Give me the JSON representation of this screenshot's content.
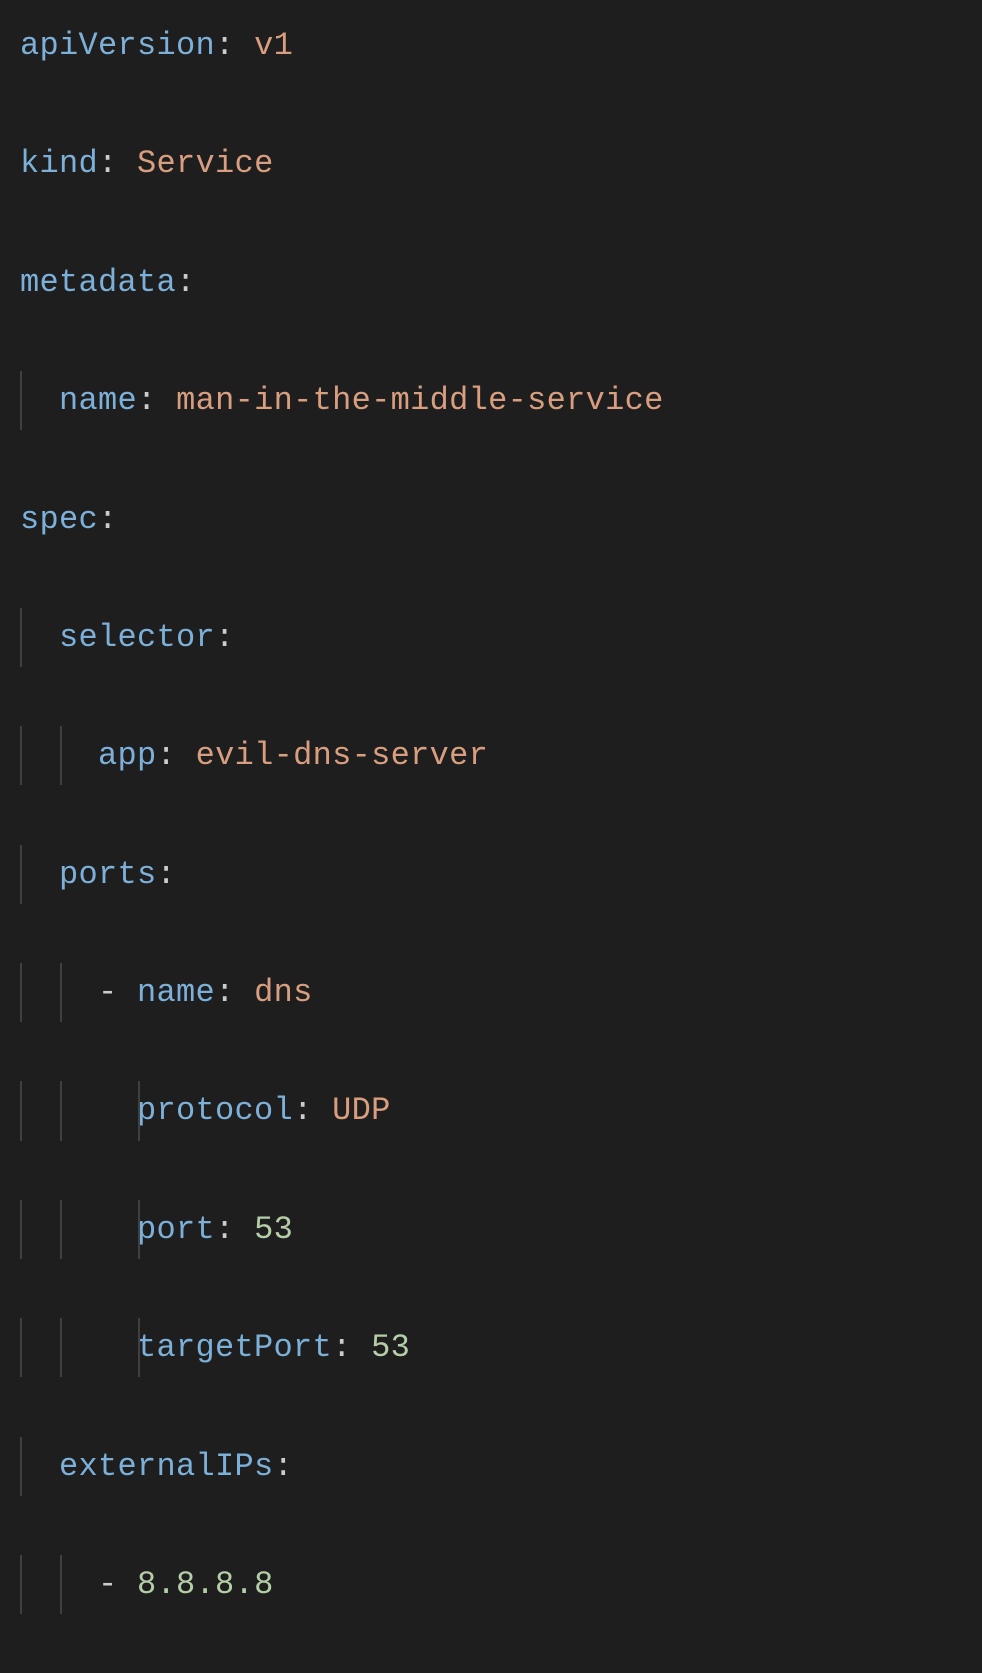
{
  "yaml": {
    "apiVersion_key": "apiVersion",
    "apiVersion_val": "v1",
    "kind_key": "kind",
    "kind_val": "Service",
    "metadata_key": "metadata",
    "metadata_name_key": "name",
    "metadata_name_val": "man-in-the-middle-service",
    "spec_key": "spec",
    "selector_key": "selector",
    "selector_app_key": "app",
    "selector_app_val": "evil-dns-server",
    "ports_key": "ports",
    "ports_name_key": "name",
    "ports_name_val": "dns",
    "ports_protocol_key": "protocol",
    "ports_protocol_val": "UDP",
    "ports_port_key": "port",
    "ports_port_val": "53",
    "ports_targetPort_key": "targetPort",
    "ports_targetPort_val": "53",
    "externalIPs_key": "externalIPs",
    "externalIPs_val": "8.8.8.8"
  }
}
